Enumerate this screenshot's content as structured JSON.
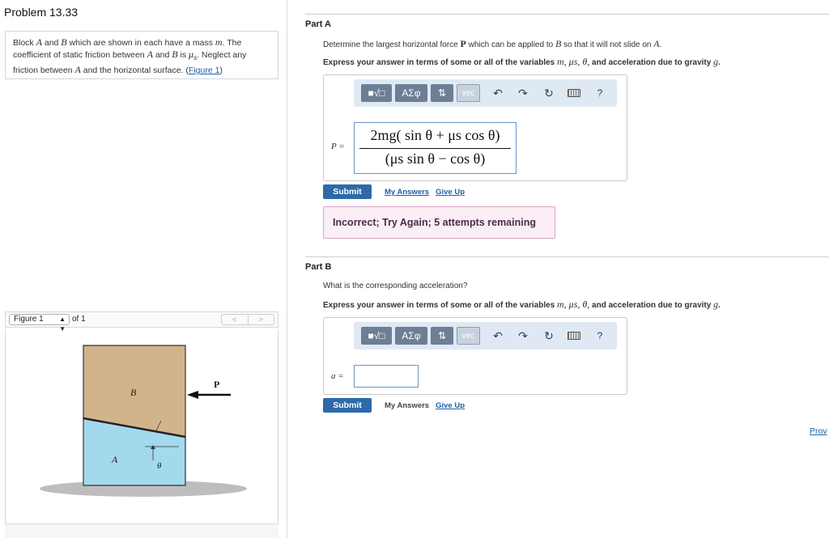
{
  "problem": {
    "title": "Problem 13.33",
    "statement": {
      "s1": "Block ",
      "A": "A",
      "s2": " and ",
      "B": "B",
      "s3": " which are shown in each have a mass ",
      "m": "m",
      "s4": ". The coefficient of static friction between ",
      "A2": "A",
      "s5": " and ",
      "B2": "B",
      "s6": " is ",
      "mu": "μ",
      "mu_sub": "s",
      "s7": ". Neglect any friction between ",
      "A3": "A",
      "s8": " and the horizontal surface. (",
      "figure_link": "Figure 1",
      "s9": ")"
    }
  },
  "figure": {
    "selector_value": "Figure 1",
    "of_text": "of 1",
    "prev": "<",
    "next": ">",
    "label_B": "B",
    "label_A": "A",
    "label_P": "P",
    "label_theta": "θ",
    "colors": {
      "block_B": "#d2b48c",
      "block_A": "#a3d9ec",
      "ground": "#bdbdbd"
    }
  },
  "partA": {
    "label": "Part A",
    "question_pre": "Determine the largest horizontal force ",
    "question_P": "P",
    "question_mid": " which can be applied to ",
    "question_B": "B",
    "question_post": " so that it will not slide on ",
    "question_A": "A",
    "question_end": ".",
    "express_pre": "Express your answer in terms of some or all of the variables ",
    "express_vars": "m, μs, θ,",
    "express_post": " and acceleration due to gravity ",
    "express_g": "g",
    "express_end": ".",
    "var": "P =",
    "answer_numerator": "2mg( sin θ + μs cos θ)",
    "answer_denominator": "(μs sin θ − cos θ)",
    "submit": "Submit",
    "my_answers": "My Answers",
    "give_up": "Give Up",
    "feedback": "Incorrect; Try Again; 5 attempts remaining"
  },
  "partB": {
    "label": "Part B",
    "question": "What is the corresponding acceleration?",
    "express_pre": "Express your answer in terms of some or all of the variables ",
    "express_vars": "m, μs, θ,",
    "express_post": " and acceleration due to gravity ",
    "express_g": "g",
    "express_end": ".",
    "var": "a =",
    "submit": "Submit",
    "my_answers": "My Answers",
    "give_up": "Give Up"
  },
  "toolbar": {
    "templates": "■√□",
    "greek": "ΑΣφ",
    "arrows": "⇅",
    "vec": "vec",
    "undo": "↶",
    "redo": "↷",
    "reset": "↻",
    "help": "?"
  },
  "provide_feedback": "Prov"
}
